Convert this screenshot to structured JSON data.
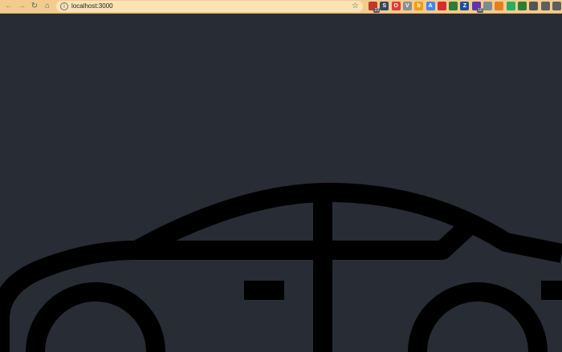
{
  "browser": {
    "url": "localhost:3000",
    "icons": {
      "back": "arrow-left-icon",
      "forward": "arrow-right-icon",
      "reload": "reload-icon",
      "home": "home-icon",
      "info": "info-icon",
      "bookmark": "star-icon"
    },
    "extensions": [
      {
        "name": "calendar-extension-icon",
        "glyph": "",
        "badge": "23",
        "color": "#c0392b"
      },
      {
        "name": "s-extension-icon",
        "glyph": "S",
        "badge": "",
        "color": "#34495e"
      },
      {
        "name": "opera-extension-icon",
        "glyph": "O",
        "badge": "",
        "color": "#e53935"
      },
      {
        "name": "v-extension-icon",
        "glyph": "V",
        "badge": "",
        "color": "#8e8e8e"
      },
      {
        "name": "b-extension-icon",
        "glyph": "b",
        "badge": "",
        "color": "#f39c12"
      },
      {
        "name": "translate-extension-icon",
        "glyph": "A",
        "badge": "",
        "color": "#4285f4"
      },
      {
        "name": "red-square-extension-icon",
        "glyph": "",
        "badge": "",
        "color": "#d32f2f"
      },
      {
        "name": "grid-extension-icon",
        "glyph": "",
        "badge": "",
        "color": "#2e7d32"
      },
      {
        "name": "z-extension-icon",
        "glyph": "Z",
        "badge": "",
        "color": "#1a4fa0"
      },
      {
        "name": "hat-extension-icon",
        "glyph": "",
        "badge": "10",
        "color": "#5e35b1"
      },
      {
        "name": "sparkle-extension-icon",
        "glyph": "",
        "badge": "",
        "color": "#7f8c8d"
      },
      {
        "name": "pinwheel-extension-icon",
        "glyph": "",
        "badge": "",
        "color": "#e67e22"
      },
      {
        "name": "image-extension-icon",
        "glyph": "",
        "badge": "",
        "color": "#27ae60"
      },
      {
        "name": "map-pin-extension-icon",
        "glyph": "",
        "badge": "",
        "color": "#2e7d32"
      },
      {
        "name": "box-extension-icon",
        "glyph": "",
        "badge": "",
        "color": "#555555"
      },
      {
        "name": "puzzle-extension-icon",
        "glyph": "",
        "badge": "",
        "color": "#5f5f5f"
      },
      {
        "name": "menu-extension-icon",
        "glyph": "",
        "badge": "",
        "color": "#5f5f5f"
      }
    ]
  },
  "page": {
    "background": "#282c34",
    "illustration": "car-outline-icon",
    "illustration_color": "#000000"
  }
}
